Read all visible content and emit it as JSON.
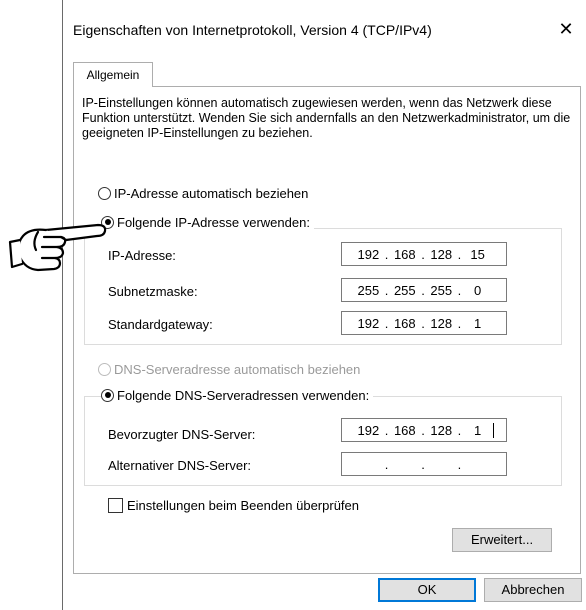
{
  "window": {
    "title": "Eigenschaften von Internetprotokoll, Version 4 (TCP/IPv4)",
    "close_glyph": "✕"
  },
  "tab": {
    "label": "Allgemein"
  },
  "description": "IP-Einstellungen können automatisch zugewiesen werden, wenn das Netzwerk diese Funktion unterstützt. Wenden Sie sich andernfalls an den Netzwerkadministrator, um die geeigneten IP-Einstellungen zu beziehen.",
  "ip_mode": {
    "auto_label": "IP-Adresse automatisch beziehen",
    "manual_label": "Folgende IP-Adresse verwenden:",
    "selected": "manual"
  },
  "ip_fields": [
    {
      "label": "IP-Adresse:",
      "octets": [
        "192",
        "168",
        "128",
        "15"
      ]
    },
    {
      "label": "Subnetzmaske:",
      "octets": [
        "255",
        "255",
        "255",
        "0"
      ]
    },
    {
      "label": "Standardgateway:",
      "octets": [
        "192",
        "168",
        "128",
        "1"
      ]
    }
  ],
  "dns_mode": {
    "auto_label": "DNS-Serveradresse automatisch beziehen",
    "manual_label": "Folgende DNS-Serveradressen verwenden:",
    "selected": "manual",
    "auto_disabled": true
  },
  "dns_fields": [
    {
      "label": "Bevorzugter DNS-Server:",
      "octets": [
        "192",
        "168",
        "128",
        "1"
      ]
    },
    {
      "label": "Alternativer DNS-Server:",
      "octets": [
        "",
        "",
        "",
        ""
      ]
    }
  ],
  "validate_checkbox": {
    "label": "Einstellungen beim Beenden überprüfen",
    "checked": false
  },
  "buttons": {
    "advanced": "Erweitert...",
    "ok": "OK",
    "cancel": "Abbrechen"
  },
  "pointer_icon": "pointing-hand-icon"
}
